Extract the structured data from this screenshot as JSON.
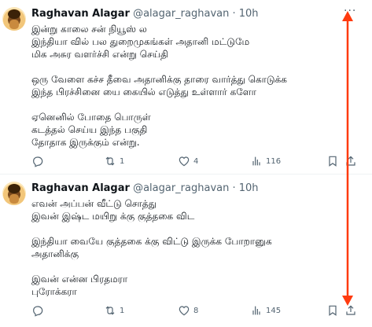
{
  "colors": {
    "accent_arrow": "#ff3b0f",
    "muted": "#536471",
    "text": "#0f1419"
  },
  "tweets": [
    {
      "author": "Raghavan Alagar",
      "handle": "@alagar_raghavan",
      "time": "· 10h",
      "lines": [
        "இன்று காலை சன் நியூஸ் ல",
        "இந்தியா வில் பல துறைமுகங்கள் அதானி மட்டுமே",
        "மிக அசுர வளர்ச்சி என்று செய்தி",
        "",
        "ஒரு வேளை கச்ச தீவை அதானிக்கு தாரை வார்த்து கொடுக்க",
        "இந்த பிரச்சினை யை கையில் எடுத்து உள்ளார் களோ",
        "",
        "ஏனெனில் போதை பொருள்",
        "கடத்தல் செய்ய இந்த பகுதி",
        "தோதாக இருக்கும் என்று."
      ],
      "stats": {
        "replies": "",
        "retweets": "1",
        "likes": "4",
        "views": "116"
      }
    },
    {
      "author": "Raghavan Alagar",
      "handle": "@alagar_raghavan",
      "time": "· 10h",
      "lines": [
        "எவன் அப்பன் வீட்டு சொத்து",
        "இவன் இஷ்ட மயிறு க்கு குத்தகை விட",
        "",
        "இந்தியா வையே குத்தகை க்கு விட்டு இருக்க போறானுக",
        "அதானிக்கு",
        "",
        "இவன் என்ன பிரதமரா",
        "புரோக்கரா"
      ],
      "stats": {
        "replies": "",
        "retweets": "1",
        "likes": "8",
        "views": "145"
      }
    }
  ]
}
